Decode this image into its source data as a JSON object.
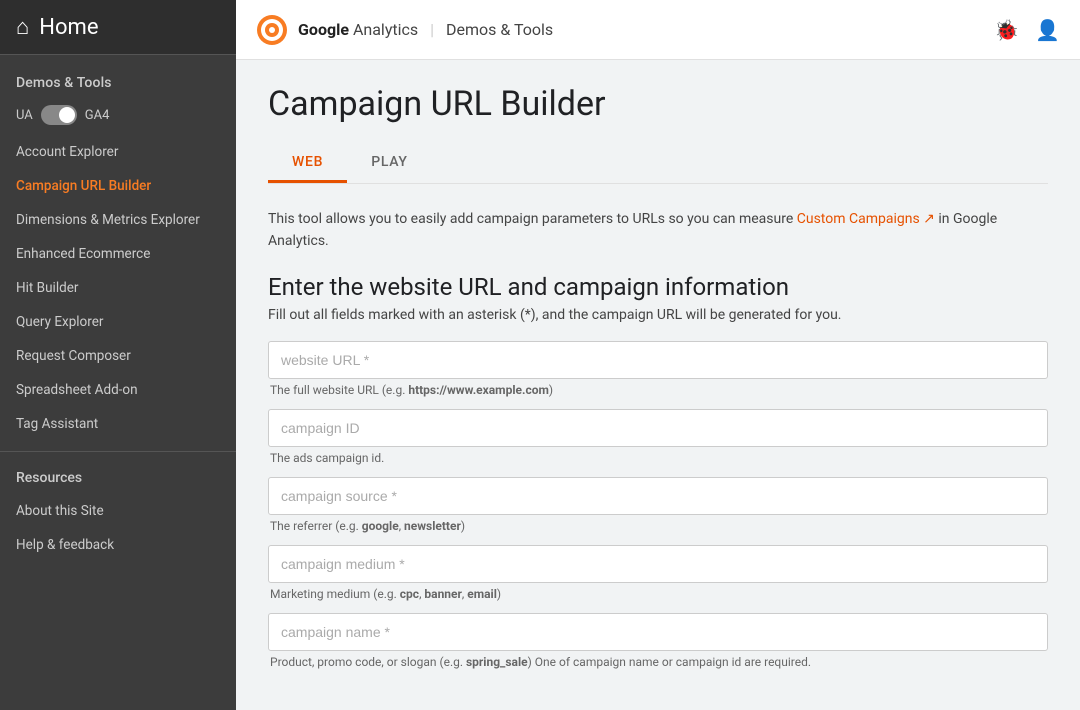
{
  "sidebar": {
    "home_label": "Home",
    "demos_tools_title": "Demos & Tools",
    "ua_label": "UA",
    "ga4_label": "GA4",
    "nav_items": [
      {
        "id": "account-explorer",
        "label": "Account Explorer",
        "active": false
      },
      {
        "id": "campaign-url-builder",
        "label": "Campaign URL Builder",
        "active": true
      },
      {
        "id": "dimensions-metrics",
        "label": "Dimensions & Metrics Explorer",
        "active": false
      },
      {
        "id": "enhanced-ecommerce",
        "label": "Enhanced Ecommerce",
        "active": false
      },
      {
        "id": "hit-builder",
        "label": "Hit Builder",
        "active": false
      },
      {
        "id": "query-explorer",
        "label": "Query Explorer",
        "active": false
      },
      {
        "id": "request-composer",
        "label": "Request Composer",
        "active": false
      },
      {
        "id": "spreadsheet-add-on",
        "label": "Spreadsheet Add-on",
        "active": false
      },
      {
        "id": "tag-assistant",
        "label": "Tag Assistant",
        "active": false
      }
    ],
    "resources_title": "Resources",
    "resource_items": [
      {
        "id": "about-this-site",
        "label": "About this Site"
      },
      {
        "id": "help-feedback",
        "label": "Help & feedback"
      }
    ]
  },
  "header": {
    "brand_google": "Google",
    "brand_analytics": " Analytics",
    "brand_separator": "|",
    "brand_subtitle": "Demos & Tools",
    "bug_icon": "🐞",
    "account_icon": "👤"
  },
  "page": {
    "title": "Campaign URL Builder",
    "tabs": [
      {
        "id": "web",
        "label": "WEB",
        "active": true
      },
      {
        "id": "play",
        "label": "PLAY",
        "active": false
      }
    ],
    "description_part1": "This tool allows you to easily add campaign parameters to URLs so you can measure ",
    "description_link": "Custom Campaigns",
    "description_part2": " in Google Analytics.",
    "form_title": "Enter the website URL and campaign information",
    "form_subtitle": "Fill out all fields marked with an asterisk (*), and the campaign URL will be generated for you.",
    "fields": [
      {
        "id": "website-url",
        "placeholder": "website URL *",
        "hint": "The full website URL (e.g. https://www.example.com)",
        "hint_bold": "https://www.example.com"
      },
      {
        "id": "campaign-id",
        "placeholder": "campaign ID",
        "hint": "The ads campaign id."
      },
      {
        "id": "campaign-source",
        "placeholder": "campaign source *",
        "hint_prefix": "The referrer (e.g. ",
        "hint_bold_parts": [
          "google",
          "newsletter"
        ],
        "hint_suffix": ")"
      },
      {
        "id": "campaign-medium",
        "placeholder": "campaign medium *",
        "hint_prefix": "Marketing medium (e.g. ",
        "hint_bold_parts": [
          "cpc",
          "banner",
          "email"
        ],
        "hint_suffix": ")"
      },
      {
        "id": "campaign-name",
        "placeholder": "campaign name *",
        "hint_prefix": "Product, promo code, or slogan (e.g. ",
        "hint_bold_parts": [
          "spring_sale"
        ],
        "hint_suffix": ") One of campaign name or campaign id are required."
      }
    ]
  }
}
